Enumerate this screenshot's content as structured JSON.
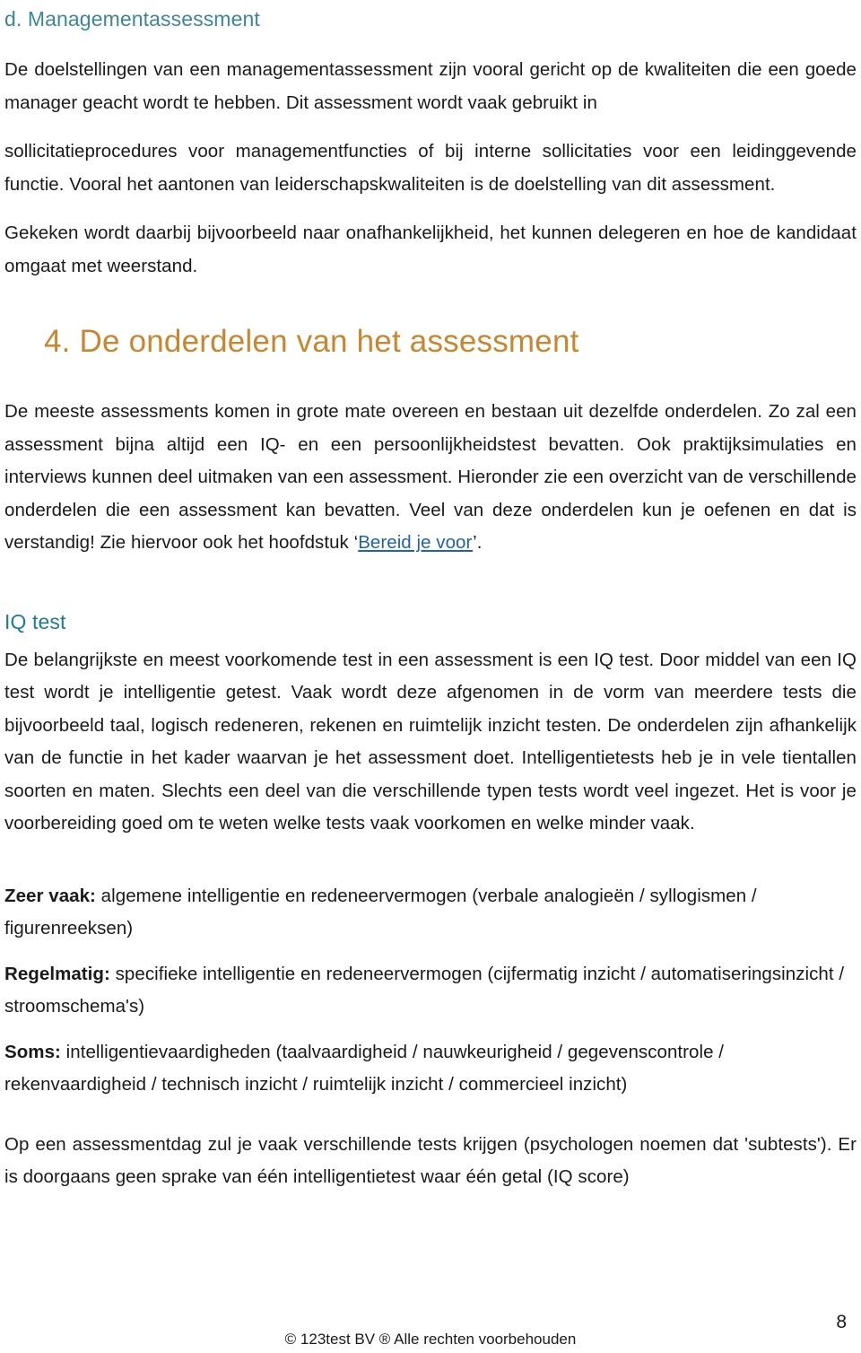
{
  "document": {
    "subheading_d": "d. Managementassessment",
    "paragraphs_d": [
      "De doelstellingen van een managementassessment zijn vooral gericht op de kwaliteiten die een goede manager geacht wordt te hebben. Dit assessment wordt vaak gebruikt in",
      "sollicitatieprocedures voor managementfuncties of bij interne sollicitaties voor een leidinggevende functie. Vooral het aantonen van leiderschapskwaliteiten is de doelstelling van dit assessment.",
      "Gekeken wordt daarbij bijvoorbeeld naar onafhankelijkheid, het kunnen delegeren en hoe de kandidaat omgaat met weerstand."
    ],
    "chapter_heading": "4. De onderdelen van het assessment",
    "chapter_intro_before_link": "De meeste assessments komen in grote mate overeen en bestaan uit dezelfde onderdelen. Zo zal een assessment bijna altijd een IQ- en een persoonlijkheidstest bevatten. Ook praktijksimulaties en interviews kunnen deel uitmaken van een assessment. Hieronder zie een overzicht van de verschillende onderdelen die een assessment kan bevatten. Veel van deze onderdelen kun je oefenen en dat is verstandig! Zie hiervoor ook het hoofdstuk ‘",
    "chapter_intro_link": "Bereid je voor",
    "chapter_intro_after_link": "’.",
    "section_iq_heading": "IQ test",
    "section_iq_paragraph": "De belangrijkste en meest voorkomende test in een assessment is een IQ test. Door middel van een IQ test wordt je intelligentie getest. Vaak wordt deze afgenomen in de vorm van meerdere tests die bijvoorbeeld taal, logisch redeneren, rekenen en ruimtelijk inzicht testen. De onderdelen zijn afhankelijk van de functie in het kader waarvan je het assessment doet. Intelligentietests heb je in vele tientallen soorten en maten. Slechts een deel van die verschillende typen tests wordt veel ingezet. Het is voor je voorbereiding goed om te weten welke tests vaak voorkomen en welke minder vaak.",
    "frequency_items": [
      {
        "label": "Zeer vaak:",
        "text": " algemene intelligentie en redeneervermogen (verbale analogieën / syllogismen / figurenreeksen)"
      },
      {
        "label": "Regelmatig:",
        "text": " specifieke intelligentie en redeneervermogen (cijfermatig inzicht / automatiseringsinzicht / stroomschema's)"
      },
      {
        "label": "Soms:",
        "text": " intelligentievaardigheden (taalvaardigheid / nauwkeurigheid / gegevenscontrole / rekenvaardigheid / technisch inzicht / ruimtelijk inzicht / commercieel inzicht)"
      }
    ],
    "closing_paragraph": "Op een assessmentdag zul je vaak verschillende tests krijgen (psychologen noemen dat 'subtests'). Er is doorgaans geen sprake van één intelligentietest waar één getal (IQ score)",
    "page_number": "8",
    "footer": "© 123test BV ® Alle rechten voorbehouden",
    "colors": {
      "subheading_teal": "#3C8797",
      "chapter_orange": "#C9862E",
      "section_teal": "#1C7C94",
      "link_blue": "#1F63B0",
      "body_text": "#1a1a1a",
      "background": "#ffffff"
    }
  }
}
